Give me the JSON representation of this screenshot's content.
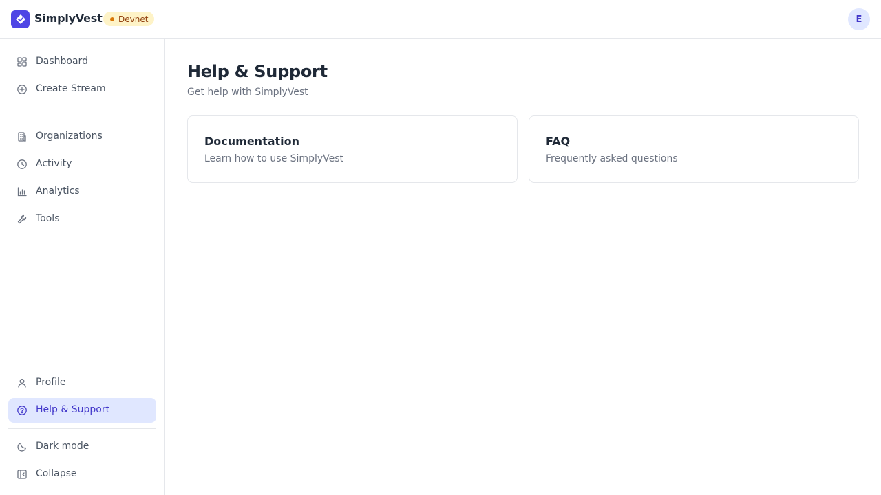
{
  "header": {
    "brand": "SimplyVest",
    "network_badge": "Devnet",
    "avatar_initial": "E"
  },
  "sidebar": {
    "primary": [
      {
        "label": "Dashboard",
        "icon": "dashboard-icon"
      },
      {
        "label": "Create Stream",
        "icon": "plus-circle-icon"
      }
    ],
    "secondary": [
      {
        "label": "Organizations",
        "icon": "building-icon"
      },
      {
        "label": "Activity",
        "icon": "clock-icon"
      },
      {
        "label": "Analytics",
        "icon": "bar-chart-icon"
      },
      {
        "label": "Tools",
        "icon": "wrench-icon"
      }
    ],
    "account": [
      {
        "label": "Profile",
        "icon": "user-icon"
      },
      {
        "label": "Help & Support",
        "icon": "help-circle-icon",
        "active": true
      }
    ],
    "footer": [
      {
        "label": "Dark mode",
        "icon": "moon-icon"
      },
      {
        "label": "Collapse",
        "icon": "collapse-icon"
      }
    ]
  },
  "main": {
    "title": "Help & Support",
    "subtitle": "Get help with SimplyVest",
    "cards": [
      {
        "title": "Documentation",
        "description": "Learn how to use SimplyVest"
      },
      {
        "title": "FAQ",
        "description": "Frequently asked questions"
      }
    ]
  },
  "colors": {
    "accent": "#4f46e5",
    "active_bg": "#e0e7ff",
    "badge_bg": "#fef3c7",
    "border": "#e5e7eb"
  }
}
